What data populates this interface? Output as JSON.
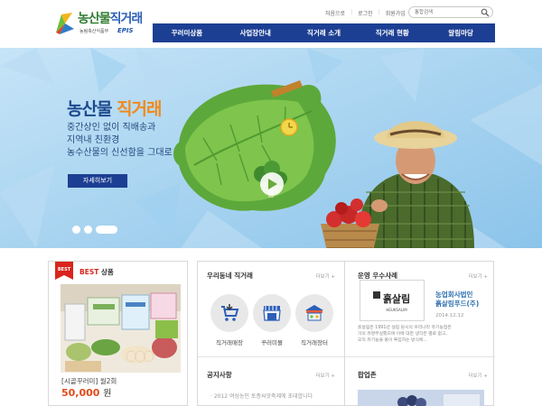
{
  "header": {
    "logo_title_main": "농산물",
    "logo_title_sub": "직거래",
    "logo_subtitle": "농림축산식품부",
    "logo_epis": "EPIS",
    "util_links": [
      "처음으로",
      "로그인",
      "회원가입"
    ],
    "search_placeholder": "통합검색",
    "search_icon": "search-icon"
  },
  "nav": {
    "items": [
      "꾸러미상품",
      "사업장안내",
      "직거래 소개",
      "직거래 현황",
      "알림마당"
    ],
    "color": "#1d3f93"
  },
  "hero": {
    "title_main": "농산물",
    "title_accent": "직거래",
    "lines": [
      "중간상인 없이 직배송과",
      "지역내 친환경",
      "농수산물의 신선함을 그대로"
    ],
    "button_label": "자세히보기",
    "slide_count": 3,
    "active_slide": 1
  },
  "best": {
    "badge": "BEST",
    "title_best": "BEST",
    "title_rest": " 상품",
    "product_name": "[시골꾸러미] 월2회",
    "price": "50,000",
    "price_unit": "원"
  },
  "local": {
    "title": "우리동네 직거래",
    "more": "더보기 +",
    "items": [
      {
        "label": "직거래매장",
        "icon": "cart-icon"
      },
      {
        "label": "꾸러미몰",
        "icon": "store-icon"
      },
      {
        "label": "직거래장터",
        "icon": "market-tent-icon"
      }
    ]
  },
  "notice": {
    "title": "공지사항",
    "more": "더보기 +",
    "items": [
      "· 2012 여성농민 토종씨앗축제에 초대합니다"
    ]
  },
  "excellent": {
    "title": "운영 우수사례",
    "more": "더보기 +",
    "shop_logo_text": "흙살림",
    "shop_logo_en": "HEUKSALIM",
    "shop_name_1": "농업회사법인",
    "shop_name_2": "흙살림푸드(주)",
    "date": "2014.12.12",
    "desc": [
      "흙살림은 1991년 설립 당시의 우리나라 유기농업은",
      "거의 유명무실했으며 이에 대한 생각은 별로 없고,",
      "오직 유기농을 들이 투입하는 방식에..."
    ]
  },
  "popup": {
    "title": "팝업존",
    "more": "더보기 +"
  },
  "colors": {
    "primary": "#1d3f93",
    "accent": "#f08a1e",
    "price": "#e24a1a",
    "hero_bg": "#a9d4f0"
  }
}
